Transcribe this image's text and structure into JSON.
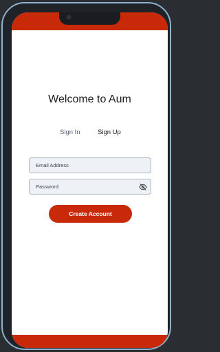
{
  "header": {
    "title": "Welcome to Aum"
  },
  "tabs": [
    {
      "label": "Sign In",
      "active": false
    },
    {
      "label": "Sign Up",
      "active": true
    }
  ],
  "form": {
    "email": {
      "value": "",
      "placeholder": "Email Address"
    },
    "password": {
      "value": "",
      "placeholder": "Password"
    },
    "submit_label": "Create Account"
  },
  "colors": {
    "accent": "#c82a09",
    "frame": "#8fb2cf",
    "field_bg": "#eef1f6"
  },
  "icons": {
    "password_toggle": "eye-off-icon"
  }
}
